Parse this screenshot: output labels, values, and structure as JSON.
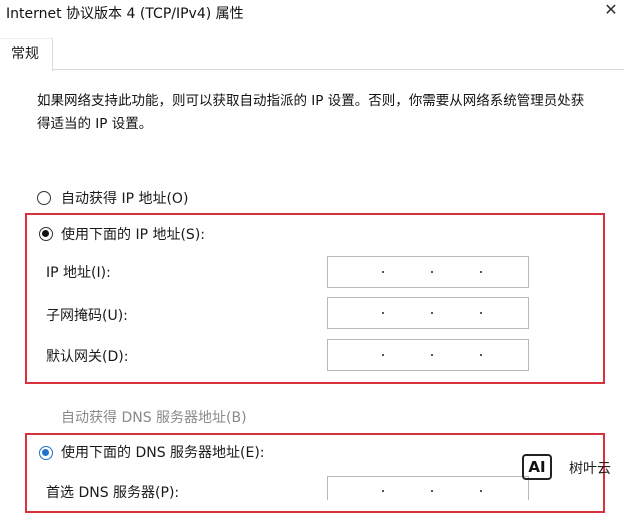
{
  "window": {
    "title": "Internet 协议版本 4 (TCP/IPv4) 属性"
  },
  "tabs": [
    {
      "label": "常规"
    }
  ],
  "description": "如果网络支持此功能，则可以获取自动指派的 IP 设置。否则，你需要从网络系统管理员处获得适当的 IP 设置。",
  "ip_section": {
    "auto_option": {
      "label": "自动获得 IP 地址(O)",
      "selected": false
    },
    "manual_option": {
      "label": "使用下面的 IP 地址(S):",
      "selected": true
    },
    "fields": [
      {
        "label": "IP 地址(I):",
        "value": ". . ."
      },
      {
        "label": "子网掩码(U):",
        "value": ". . ."
      },
      {
        "label": "默认网关(D):",
        "value": ". . ."
      }
    ]
  },
  "dns_section": {
    "auto_option": {
      "label": "自动获得 DNS 服务器地址(B)",
      "selected": false,
      "disabled": true
    },
    "manual_option": {
      "label": "使用下面的 DNS 服务器地址(E):",
      "selected": true
    },
    "fields": [
      {
        "label": "首选 DNS 服务器(P):",
        "value": ". . ."
      }
    ]
  },
  "watermark": {
    "logo": "AI",
    "text": "树叶云"
  },
  "colors": {
    "highlight_border": "#d9323f",
    "radio_selected_blue": "#1e73c9"
  },
  "icons": {
    "close": "close-icon"
  }
}
